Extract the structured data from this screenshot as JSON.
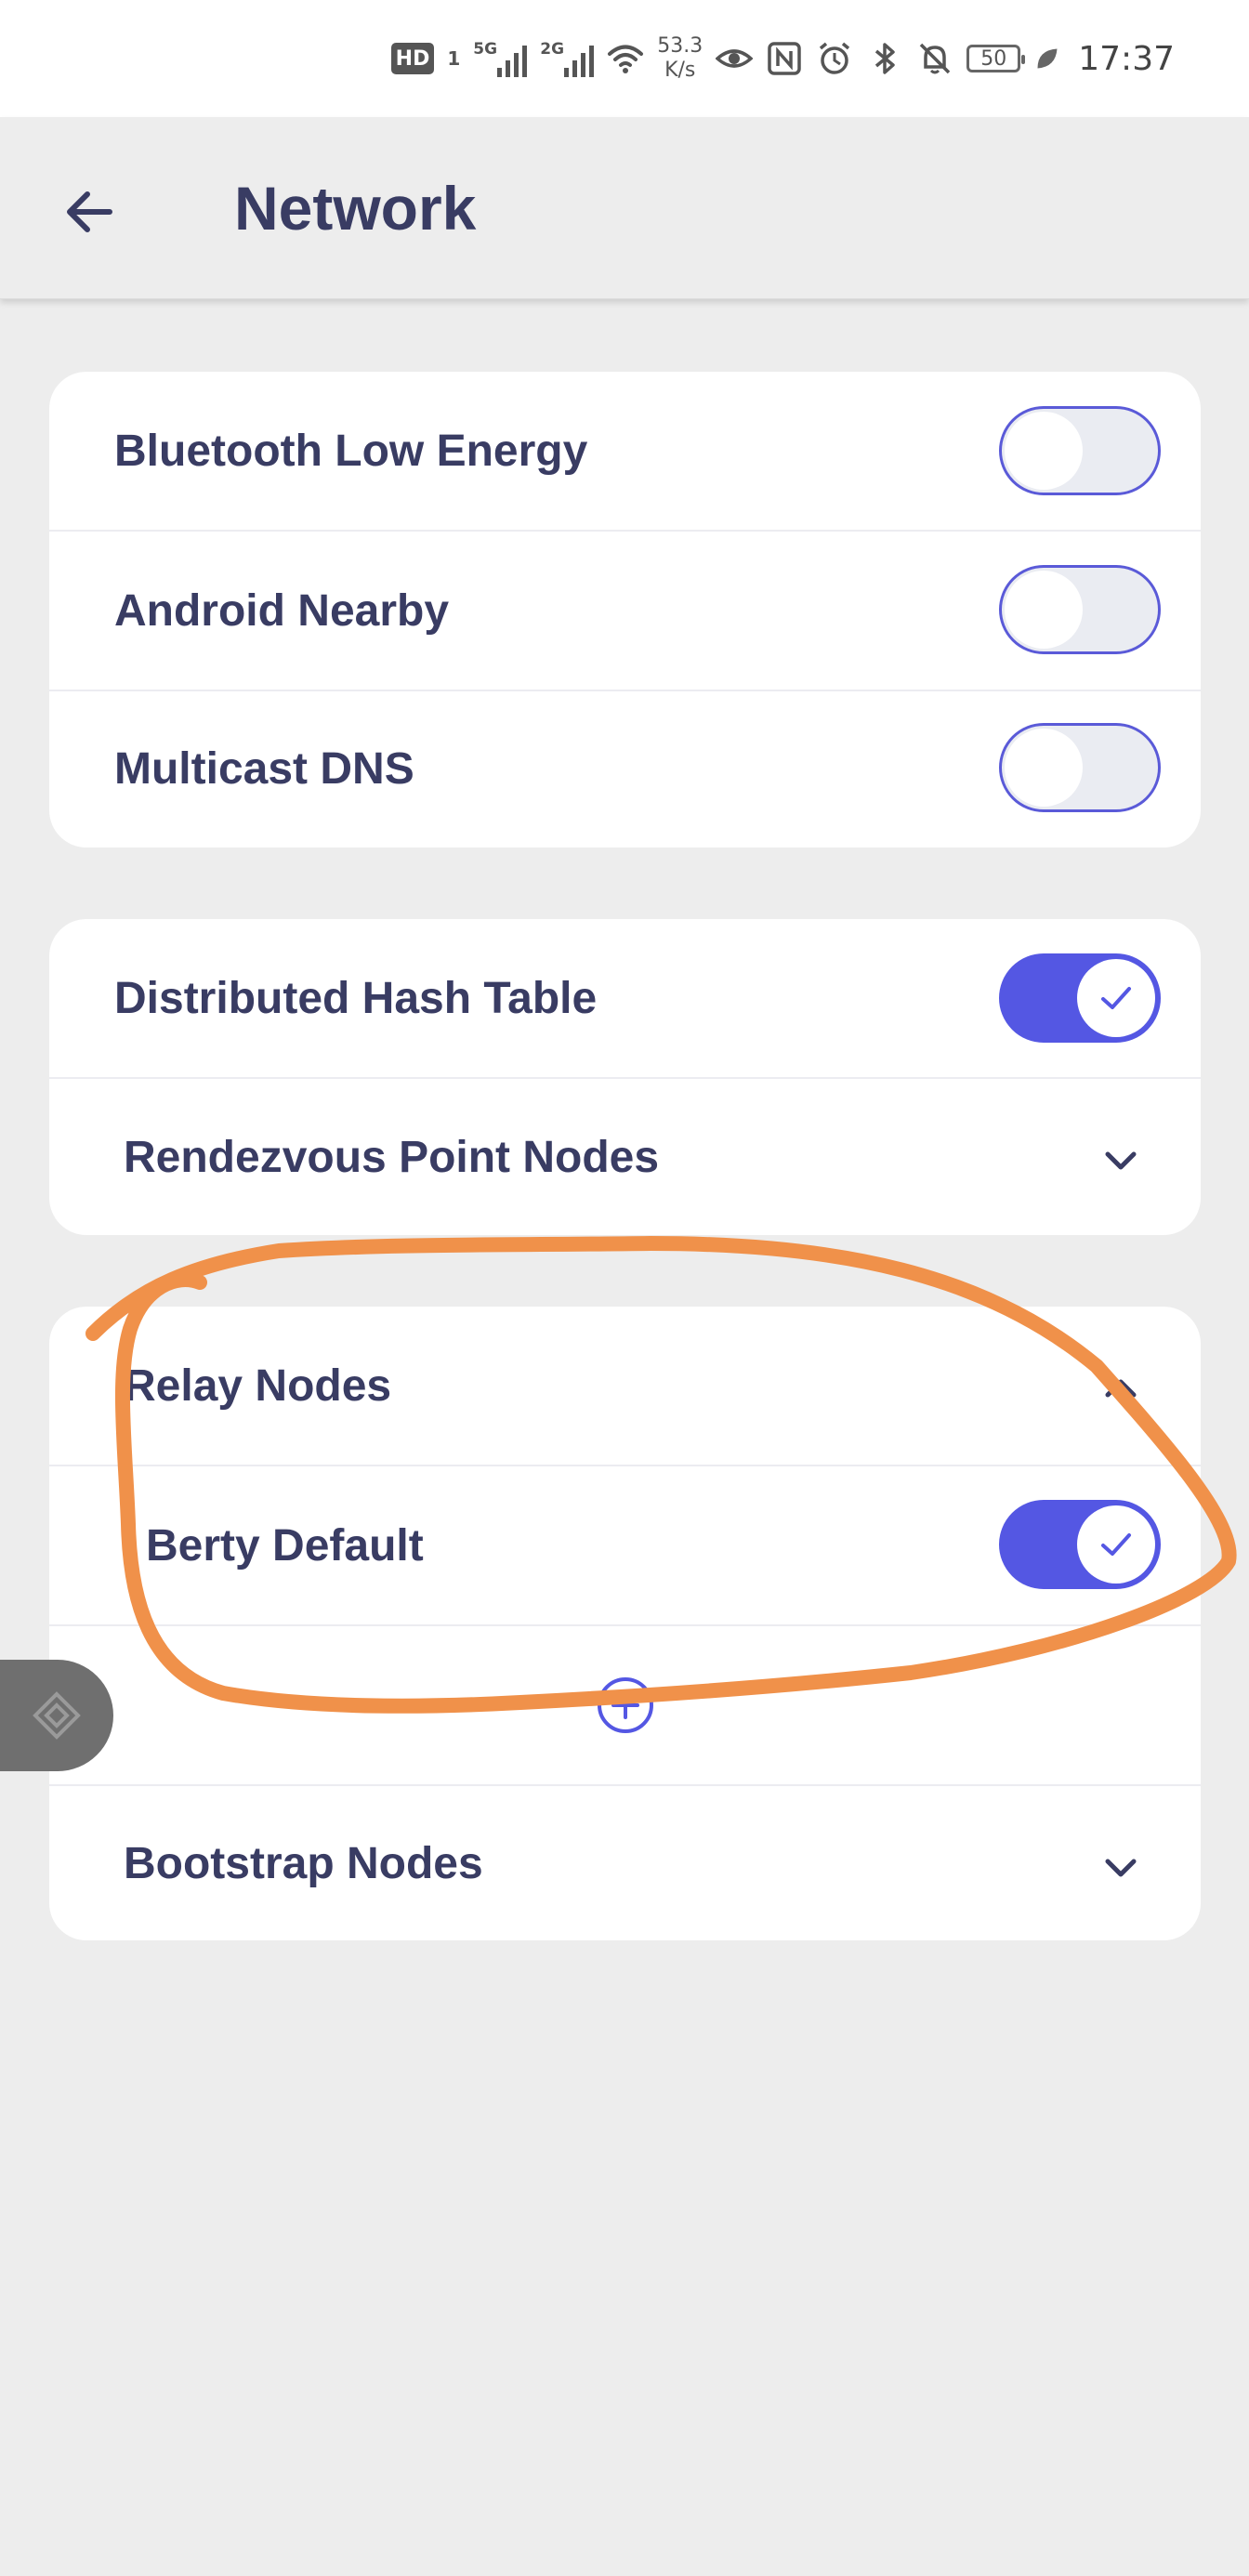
{
  "status_bar": {
    "hd_badge": "HD",
    "sim_slot": "1",
    "signal_1_label": "5G",
    "signal_2_label": "2G",
    "net_speed_value": "53.3",
    "net_speed_unit": "K/s",
    "battery": "50",
    "time": "17:37",
    "icons": [
      "hd-icon",
      "signal-icon",
      "wifi-icon",
      "eye-icon",
      "nfc-icon",
      "alarm-icon",
      "bluetooth-icon",
      "bell-off-icon",
      "battery-icon",
      "leaf-icon"
    ]
  },
  "header": {
    "back_icon": "arrow-left-icon",
    "title": "Network"
  },
  "transports": [
    {
      "label": "Bluetooth Low Energy",
      "enabled": false
    },
    {
      "label": "Android Nearby",
      "enabled": false
    },
    {
      "label": "Multicast DNS",
      "enabled": false
    }
  ],
  "dht_section": {
    "dht_label": "Distributed Hash Table",
    "dht_enabled": true,
    "rendezvous_label": "Rendezvous Point Nodes",
    "rendezvous_expanded": false
  },
  "relay_section": {
    "relay_label": "Relay Nodes",
    "relay_expanded": true,
    "default_label": "Berty Default",
    "default_enabled": true,
    "add_icon": "plus-circle-icon",
    "bootstrap_label": "Bootstrap Nodes",
    "bootstrap_expanded": false
  },
  "colors": {
    "accent": "#5457e3",
    "text": "#393c63",
    "background": "#ededed",
    "card": "#ffffff",
    "annotation": "#f0914a"
  }
}
